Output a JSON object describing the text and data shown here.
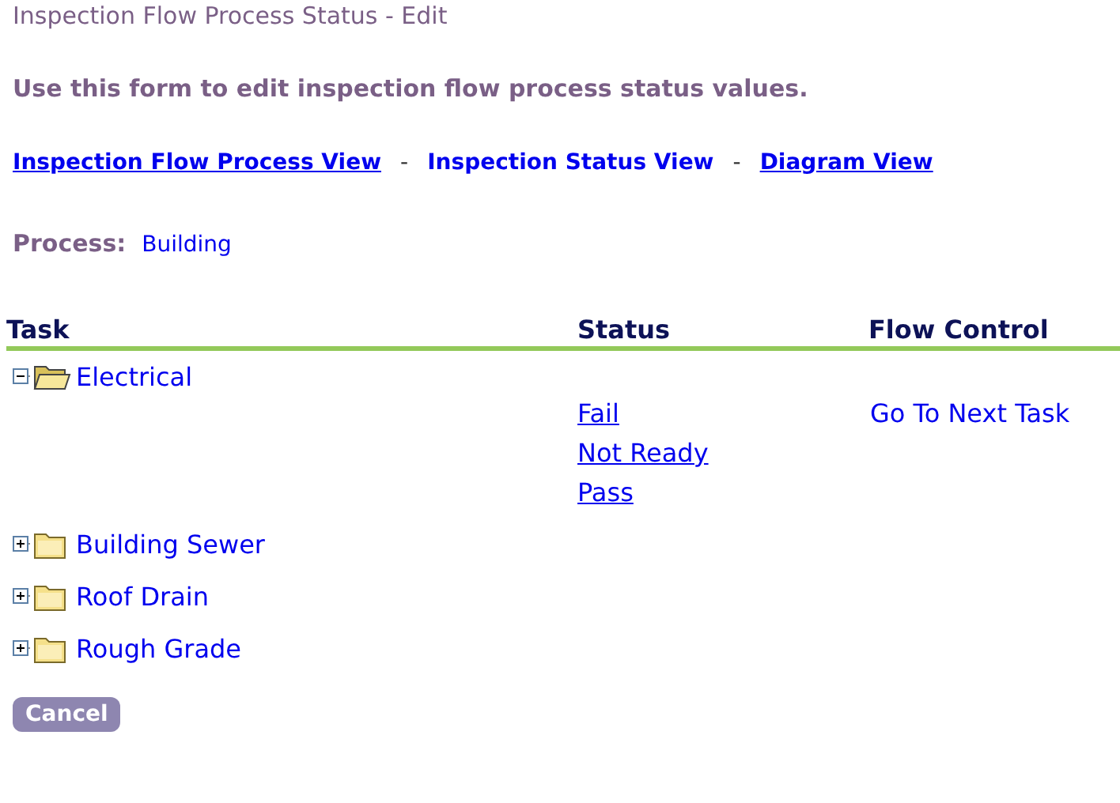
{
  "title": "Inspection Flow Process Status - Edit",
  "intro": "Use this form to edit inspection flow process status values.",
  "nav_links": [
    {
      "label": "Inspection Flow Process View",
      "underlined": true
    },
    {
      "label": "Inspection Status View",
      "underlined": false
    },
    {
      "label": "Diagram View",
      "underlined": true
    }
  ],
  "nav_separator": "-",
  "process": {
    "label": "Process:",
    "value": "Building"
  },
  "table": {
    "columns": [
      "Task",
      "Status",
      "Flow Control"
    ],
    "tasks": [
      {
        "name": "Electrical",
        "expanded": true,
        "statuses": [
          "Fail",
          "Not Ready",
          "Pass"
        ],
        "flow_control": "Go To Next Task"
      },
      {
        "name": "Building Sewer",
        "expanded": false
      },
      {
        "name": "Roof Drain",
        "expanded": false
      },
      {
        "name": "Rough Grade",
        "expanded": false
      }
    ]
  },
  "buttons": [
    "Cancel"
  ]
}
